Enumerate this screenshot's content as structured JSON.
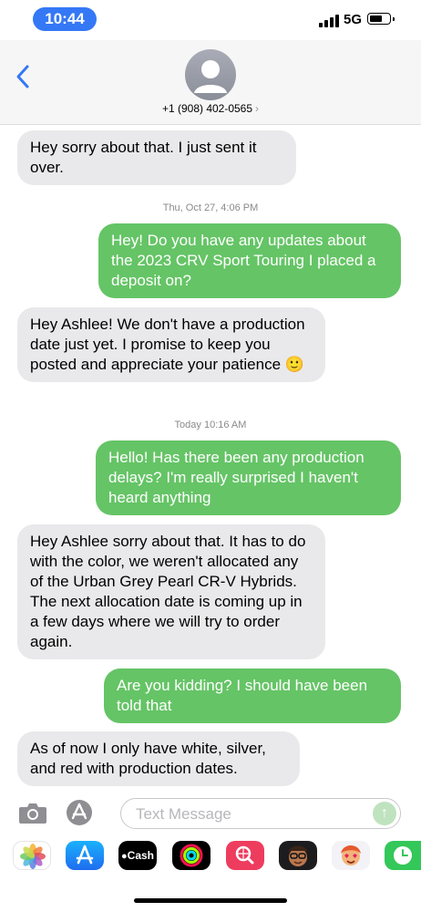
{
  "status_bar": {
    "time": "10:44",
    "network": "5G"
  },
  "header": {
    "contact": "+1 (908) 402-0565",
    "chevron": "›"
  },
  "messages": [
    {
      "dir": "in",
      "text": "Hey sorry about that. I just sent it over."
    },
    {
      "dir": "stamp",
      "text": "Thu, Oct 27, 4:06 PM"
    },
    {
      "dir": "out",
      "text": "Hey! Do you have any updates about the 2023 CRV Sport Touring I placed a deposit on?"
    },
    {
      "dir": "in",
      "text": "Hey Ashlee! We don't have a production date just yet. I promise to keep you posted and appreciate your patience 🙂"
    },
    {
      "dir": "stamp",
      "text": "Today 10:16 AM"
    },
    {
      "dir": "out",
      "text": "Hello! Has there been any production delays? I'm really surprised I haven't heard anything"
    },
    {
      "dir": "in",
      "text": "Hey Ashlee sorry about that. It has to do with the color, we weren't allocated any of the Urban Grey Pearl CR-V Hybrids. The next allocation date is coming up in a few days where we will try to order again."
    },
    {
      "dir": "out",
      "text": "Are you kidding? I should have been told that"
    },
    {
      "dir": "in",
      "text": "As of now I only have white, silver, and red with production dates."
    }
  ],
  "input": {
    "placeholder": "Text Message"
  },
  "apps": {
    "photos": "photos-icon",
    "app_store": "app-store-icon",
    "cash_label": "Cash",
    "fitness": "activity-rings-icon",
    "search": "web-search-icon",
    "memoji1": "memoji-icon",
    "memoji2": "memoji-icon",
    "clock": "clock-icon"
  },
  "colors": {
    "accent": "#3478f6",
    "outgoing": "#65c466",
    "incoming": "#e9e9eb"
  }
}
